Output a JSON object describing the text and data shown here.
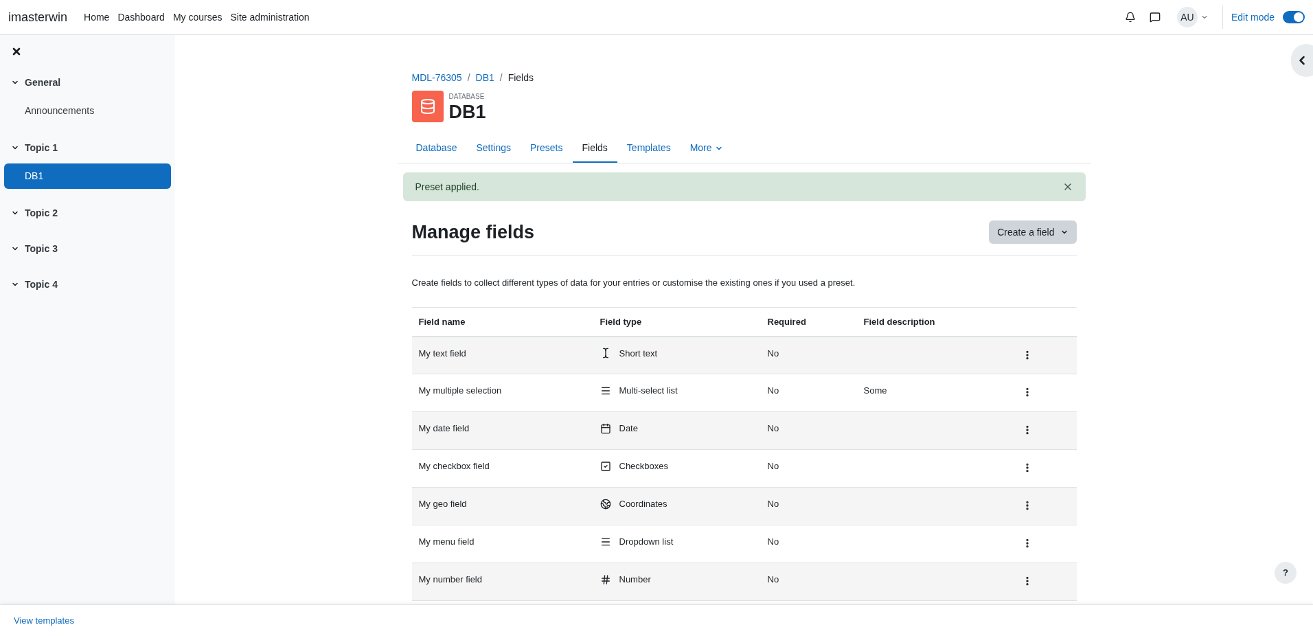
{
  "navbar": {
    "site_name": "imasterwin",
    "links": [
      "Home",
      "Dashboard",
      "My courses",
      "Site administration"
    ],
    "avatar": "AU",
    "edit_mode": {
      "label": "Edit mode",
      "on": true
    }
  },
  "sidebar": {
    "sections": [
      {
        "title": "General",
        "expanded": true,
        "items": [
          {
            "label": "Announcements",
            "selected": false
          }
        ]
      },
      {
        "title": "Topic 1",
        "expanded": true,
        "items": [
          {
            "label": "DB1",
            "selected": true
          }
        ]
      },
      {
        "title": "Topic 2",
        "expanded": true
      },
      {
        "title": "Topic 3",
        "expanded": true
      },
      {
        "title": "Topic 4",
        "expanded": true
      }
    ]
  },
  "breadcrumb": [
    {
      "kind": "link",
      "label": "MDL-76305"
    },
    {
      "kind": "separator",
      "label": "/"
    },
    {
      "kind": "link",
      "label": "DB1"
    },
    {
      "kind": "separator",
      "label": "/"
    },
    {
      "kind": "current",
      "label": "Fields"
    }
  ],
  "activity": {
    "type_label": "DATABASE",
    "title": "DB1"
  },
  "tabs": [
    {
      "label": "Database",
      "selected": false
    },
    {
      "label": "Settings",
      "selected": false
    },
    {
      "label": "Presets",
      "selected": false
    },
    {
      "label": "Fields",
      "selected": true
    },
    {
      "label": "Templates",
      "selected": false
    },
    {
      "label": "More",
      "selected": false
    }
  ],
  "alert": {
    "message": "Preset applied."
  },
  "heading": "Manage fields",
  "create_button": "Create a field",
  "intro": "Create fields to collect different types of data for your entries or customise the existing ones if you used a preset.",
  "table": {
    "columns": [
      "Field name",
      "Field type",
      "Required",
      "Field description"
    ],
    "rows": [
      {
        "name": "My text field",
        "kind": "text",
        "type": "Short text",
        "required": "No"
      },
      {
        "name": "My multiple selection",
        "kind": "list",
        "type": "Multi-select list",
        "required": "No",
        "description": "Some"
      },
      {
        "name": "My date field",
        "kind": "date",
        "type": "Date",
        "required": "No"
      },
      {
        "name": "My checkbox field",
        "kind": "checkbox",
        "type": "Checkboxes",
        "required": "No"
      },
      {
        "name": "My geo field",
        "kind": "geo",
        "type": "Coordinates",
        "required": "No"
      },
      {
        "name": "My menu field",
        "kind": "list",
        "type": "Dropdown list",
        "required": "No"
      },
      {
        "name": "My number field",
        "kind": "number",
        "type": "Number",
        "required": "No"
      }
    ]
  },
  "footer": {
    "link": "View templates"
  },
  "help_button": "?"
}
